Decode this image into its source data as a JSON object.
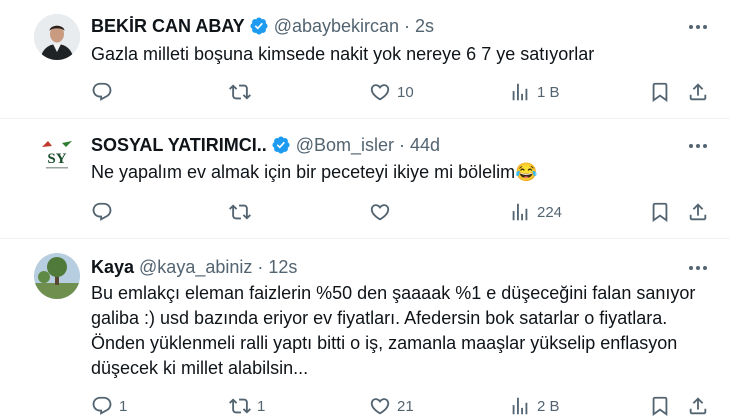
{
  "tweets": [
    {
      "name": "BEKİR CAN ABAY",
      "handle": "@abaybekircan",
      "time": "2s",
      "text": "Gazla milleti boşuna kimsede nakit yok nereye 6 7 ye satıyorlar",
      "reply_count": "",
      "retweet_count": "",
      "like_count": "10",
      "view_count": "1 B",
      "verified": true
    },
    {
      "name": "SOSYAL YATIRIMCI..",
      "handle": "@Bom_isler",
      "time": "44d",
      "text": "Ne yapalım ev almak için bir peceteyi ikiye mi bölelim😂",
      "reply_count": "",
      "retweet_count": "",
      "like_count": "",
      "view_count": "224",
      "verified": true,
      "avatar_text": "SY"
    },
    {
      "name": "Kaya",
      "handle": "@kaya_abiniz",
      "time": "12s",
      "text_lines": [
        "Bu emlakçı eleman faizlerin %50 den şaaaak %1 e düşeceğini falan sanıyor",
        "galiba :) usd bazında eriyor ev fiyatları. Afedersin bok satarlar o fiyatlara.",
        "Önden yüklenmeli ralli yaptı bitti o iş, zamanla maaşlar yükselip enflasyon",
        "düşecek ki millet alabilsin..."
      ],
      "reply_count": "1",
      "retweet_count": "1",
      "like_count": "21",
      "view_count": "2 B",
      "verified": false
    }
  ],
  "colors": {
    "text": "#0f1419",
    "secondary": "#536471",
    "verified": "#1d9bf0",
    "divider": "#eff3f4"
  },
  "icons": [
    "reply-icon",
    "retweet-icon",
    "like-icon",
    "views-icon",
    "bookmark-icon",
    "share-icon",
    "verified-badge-icon",
    "more-options-icon"
  ]
}
